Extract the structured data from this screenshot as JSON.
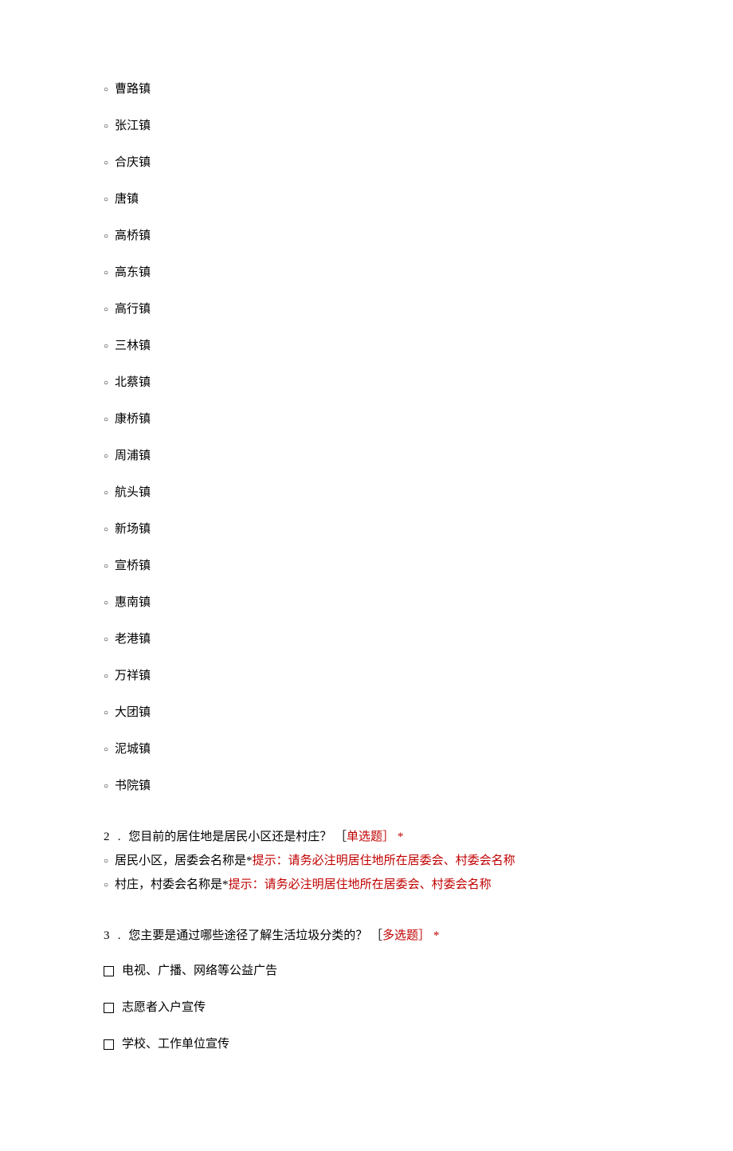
{
  "q1_options": [
    "曹路镇",
    "张江镇",
    "合庆镇",
    "唐镇",
    "高桥镇",
    "高东镇",
    "高行镇",
    "三林镇",
    "北蔡镇",
    "康桥镇",
    "周浦镇",
    "航头镇",
    "新场镇",
    "宣桥镇",
    "惠南镇",
    "老港镇",
    "万祥镇",
    "大团镇",
    "泥城镇",
    "书院镇"
  ],
  "q2": {
    "number": "2",
    "dot": ".",
    "text": "您目前的居住地是居民小区还是村庄？",
    "type_open": "［",
    "type_label": "单选题",
    "type_close": "］",
    "asterisk": "*",
    "options": [
      {
        "label": "居民小区，居委会名称是*",
        "hint": "提示：请务必注明居住地所在居委会、村委会名称"
      },
      {
        "label": "村庄，村委会名称是*",
        "hint": "提示：请务必注明居住地所在居委会、村委会名称"
      }
    ]
  },
  "q3": {
    "number": "3",
    "dot": ".",
    "text": "您主要是通过哪些途径了解生活垃圾分类的？",
    "type_open": "［",
    "type_label": "多选题",
    "type_close": "］",
    "asterisk": "*",
    "options": [
      "电视、广播、网络等公益广告",
      "志愿者入户宣传",
      "学校、工作单位宣传"
    ]
  }
}
